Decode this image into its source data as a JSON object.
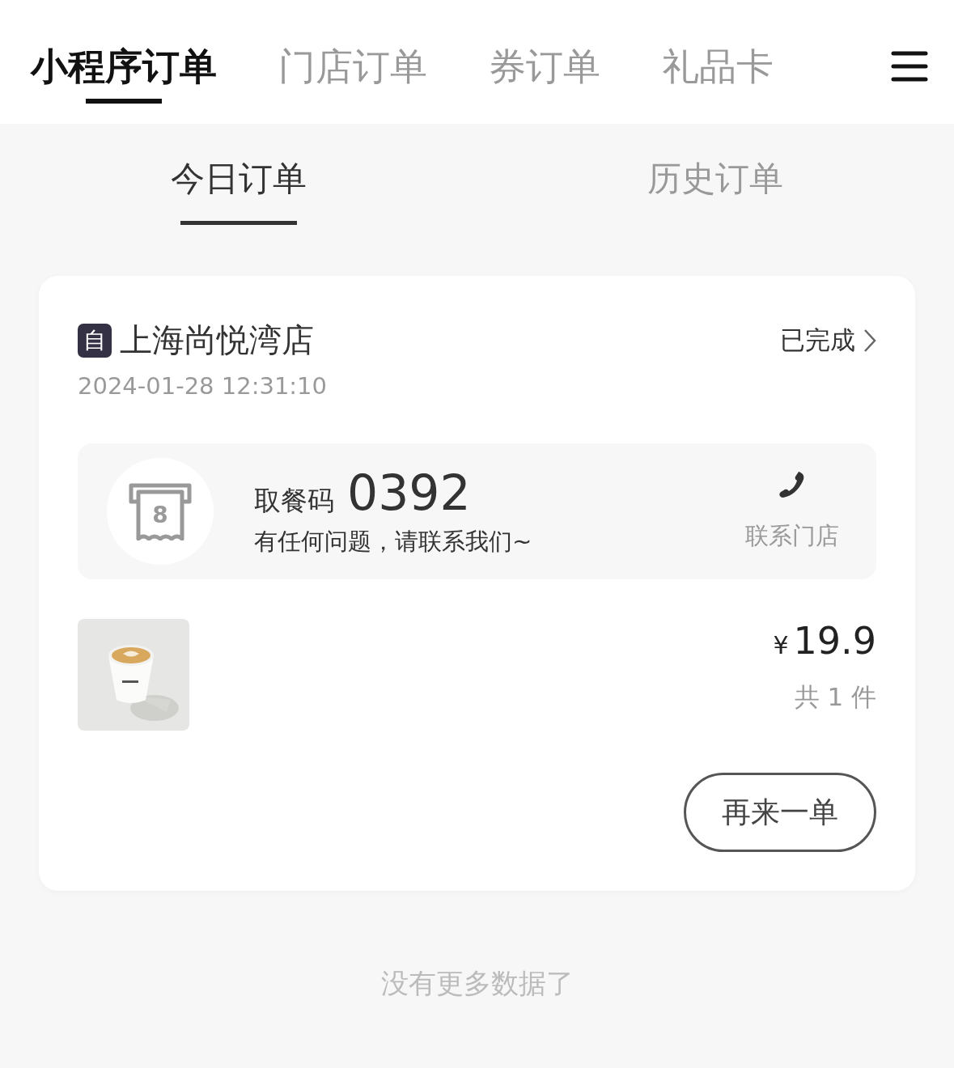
{
  "top_tabs": [
    {
      "label": "小程序订单",
      "selected": true
    },
    {
      "label": "门店订单",
      "selected": false
    },
    {
      "label": "券订单",
      "selected": false
    },
    {
      "label": "礼品卡",
      "selected": false
    }
  ],
  "sub_tabs": [
    {
      "label": "今日订单",
      "selected": true
    },
    {
      "label": "历史订单",
      "selected": false
    }
  ],
  "orders": [
    {
      "mode_badge": "自",
      "store": "上海尚悦湾店",
      "time": "2024-01-28 12:31:10",
      "status": "已完成",
      "pickup": {
        "ticket_digit": "8",
        "label": "取餐码",
        "code": "0392",
        "note": "有任何问题，请联系我们~",
        "contact": "联系门店"
      },
      "currency": "¥",
      "price": "19.9",
      "count": "共 1 件",
      "button": "再来一单"
    }
  ],
  "footer": "没有更多数据了"
}
